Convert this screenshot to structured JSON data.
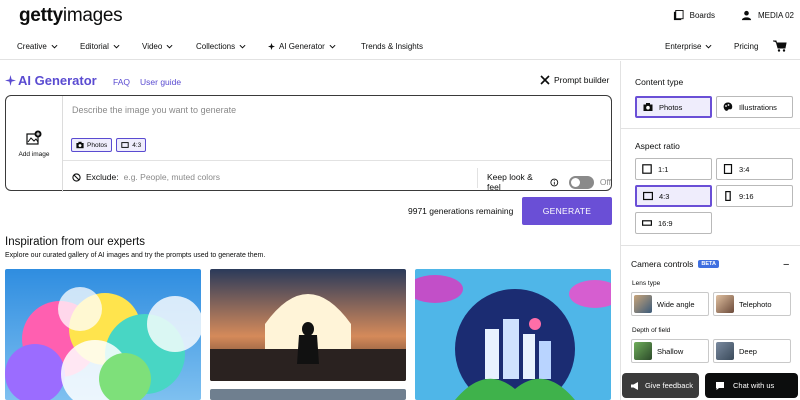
{
  "header": {
    "logo_bold": "getty",
    "logo_light": "images",
    "boards_label": "Boards",
    "account_label": "MEDIA 02"
  },
  "nav": {
    "items": [
      "Creative",
      "Editorial",
      "Video",
      "Collections",
      "AI Generator",
      "Trends & Insights"
    ],
    "right_items": [
      "Enterprise",
      "Pricing"
    ]
  },
  "generator": {
    "title": "AI Generator",
    "links": [
      "FAQ",
      "User guide"
    ],
    "prompt_builder": "Prompt builder",
    "add_image": "Add image",
    "prompt_placeholder": "Describe the image you want to generate",
    "chips": [
      "Photos",
      "4:3"
    ],
    "exclude_label": "Exclude:",
    "exclude_placeholder": "e.g. People, muted colors",
    "keep_label": "Keep look & feel",
    "keep_state": "Off",
    "remaining": "9971 generations remaining",
    "generate_label": "GENERATE"
  },
  "inspiration": {
    "title": "Inspiration from our experts",
    "subtitle": "Explore our curated gallery of AI images and try the prompts used to generate them."
  },
  "panel": {
    "content_type_label": "Content type",
    "content_types": [
      "Photos",
      "Illustrations"
    ],
    "content_selected": "Photos",
    "aspect_label": "Aspect ratio",
    "aspects": [
      "1:1",
      "3:4",
      "4:3",
      "9:16",
      "16:9"
    ],
    "aspect_selected": "4:3",
    "camera_label": "Camera controls",
    "beta": "BETA",
    "lens_label": "Lens type",
    "lens_options": [
      "Wide angle",
      "Telephoto"
    ],
    "depth_label": "Depth of field",
    "depth_options": [
      "Shallow",
      "Deep"
    ]
  },
  "footer": {
    "feedback": "Give feedback",
    "chat": "Chat with us"
  },
  "colors": {
    "accent": "#6a4fd6",
    "accent_text": "#5a4bd1",
    "selected_bg": "#efedfc"
  }
}
